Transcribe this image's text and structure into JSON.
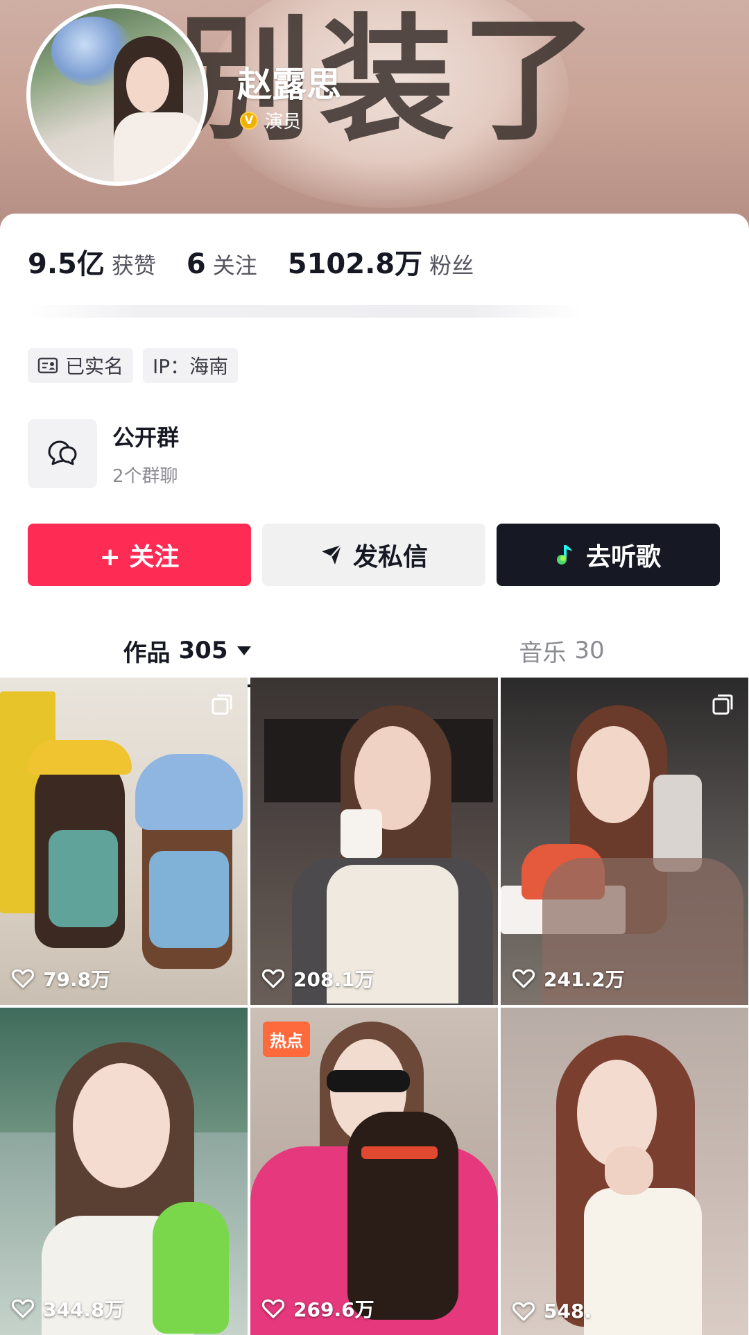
{
  "banner": {
    "text": "别装了"
  },
  "profile": {
    "name": "赵露思",
    "verify_badge": "V",
    "verify_label": "演员"
  },
  "stats": [
    {
      "value": "9.5亿",
      "label": "获赞"
    },
    {
      "value": "6",
      "label": "关注"
    },
    {
      "value": "5102.8万",
      "label": "粉丝"
    }
  ],
  "tags": [
    {
      "icon": "id-card-icon",
      "label": "已实名"
    },
    {
      "label": "IP：海南"
    }
  ],
  "group": {
    "icon": "chat-bubbles-icon",
    "title": "公开群",
    "subtitle": "2个群聊"
  },
  "actions": {
    "follow": "+ 关注",
    "message": "发私信",
    "music": "去听歌"
  },
  "tabs": {
    "works_label": "作品",
    "works_count": "305",
    "music_label": "音乐",
    "music_count": "30"
  },
  "videos": [
    {
      "likes": "79.8万",
      "multi": true
    },
    {
      "likes": "208.1万"
    },
    {
      "likes": "241.2万",
      "multi": true
    },
    {
      "likes": "344.8万"
    },
    {
      "likes": "269.6万",
      "badge": "热点"
    },
    {
      "likes": "548."
    }
  ],
  "colors": {
    "follow": "#fe2c55",
    "message_bg": "#f1f1f2",
    "music_bg": "#161823",
    "hot_badge": "#ff6a3d"
  }
}
